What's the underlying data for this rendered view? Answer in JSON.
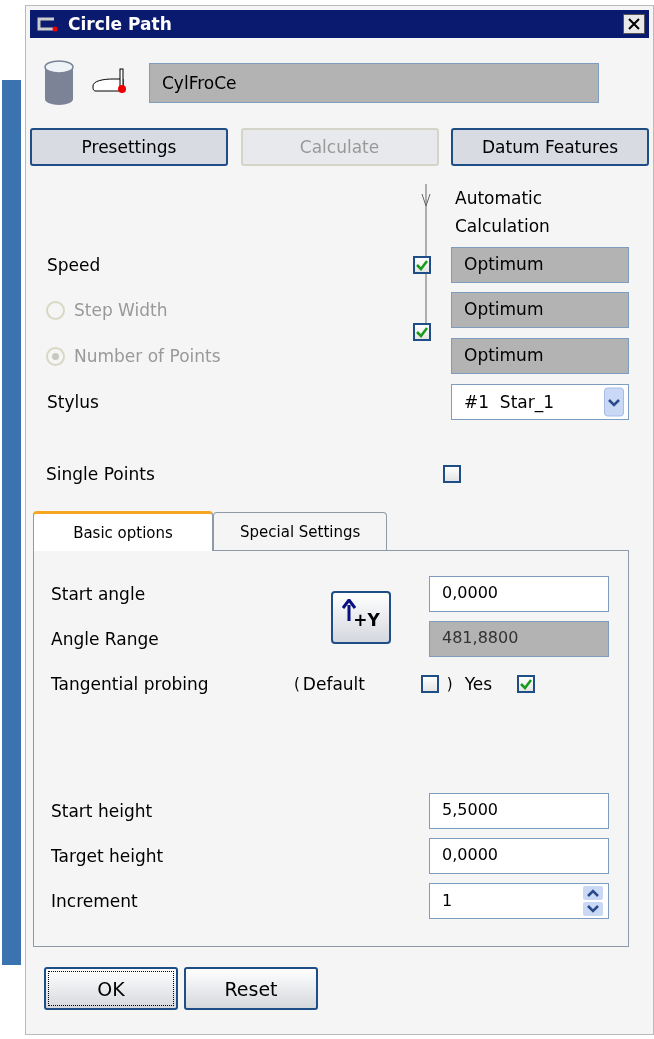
{
  "window": {
    "title": "Circle Path"
  },
  "name_field": {
    "value": "CylFroCe"
  },
  "buttons": [
    {
      "label": "Presettings",
      "disabled": false
    },
    {
      "label": "Calculate",
      "disabled": true
    },
    {
      "label": "Datum Features",
      "disabled": false
    }
  ],
  "auto_calc_header": "Automatic Calculation",
  "speed": {
    "label": "Speed",
    "auto": true,
    "value": "Optimum"
  },
  "step_mode": {
    "auto": true,
    "options": [
      {
        "label": "Step Width",
        "selected": false,
        "disabled": true,
        "value": "Optimum"
      },
      {
        "label": "Number of Points",
        "selected": true,
        "disabled": true,
        "value": "Optimum"
      }
    ]
  },
  "stylus": {
    "label": "Stylus",
    "value": "#1  Star_1"
  },
  "single_points": {
    "label": "Single Points",
    "checked": false
  },
  "tabs": [
    {
      "label": "Basic options",
      "selected": true
    },
    {
      "label": "Special Settings",
      "selected": false
    }
  ],
  "basic": {
    "start_angle": {
      "label": "Start angle",
      "value": "0,0000"
    },
    "direction_button": "+Y",
    "angle_range": {
      "label": "Angle Range",
      "value": "481,8800",
      "disabled": true
    },
    "tangential": {
      "label": "Tangential probing",
      "open": "(",
      "default_label": "Default",
      "default_checked": false,
      "close": ")",
      "yes_label": "Yes",
      "yes_checked": true
    },
    "start_height": {
      "label": "Start height",
      "value": "5,5000"
    },
    "target_height": {
      "label": "Target height",
      "value": "0,0000"
    },
    "increment": {
      "label": "Increment",
      "value": "1"
    }
  },
  "footer_buttons": [
    "OK",
    "Reset"
  ]
}
